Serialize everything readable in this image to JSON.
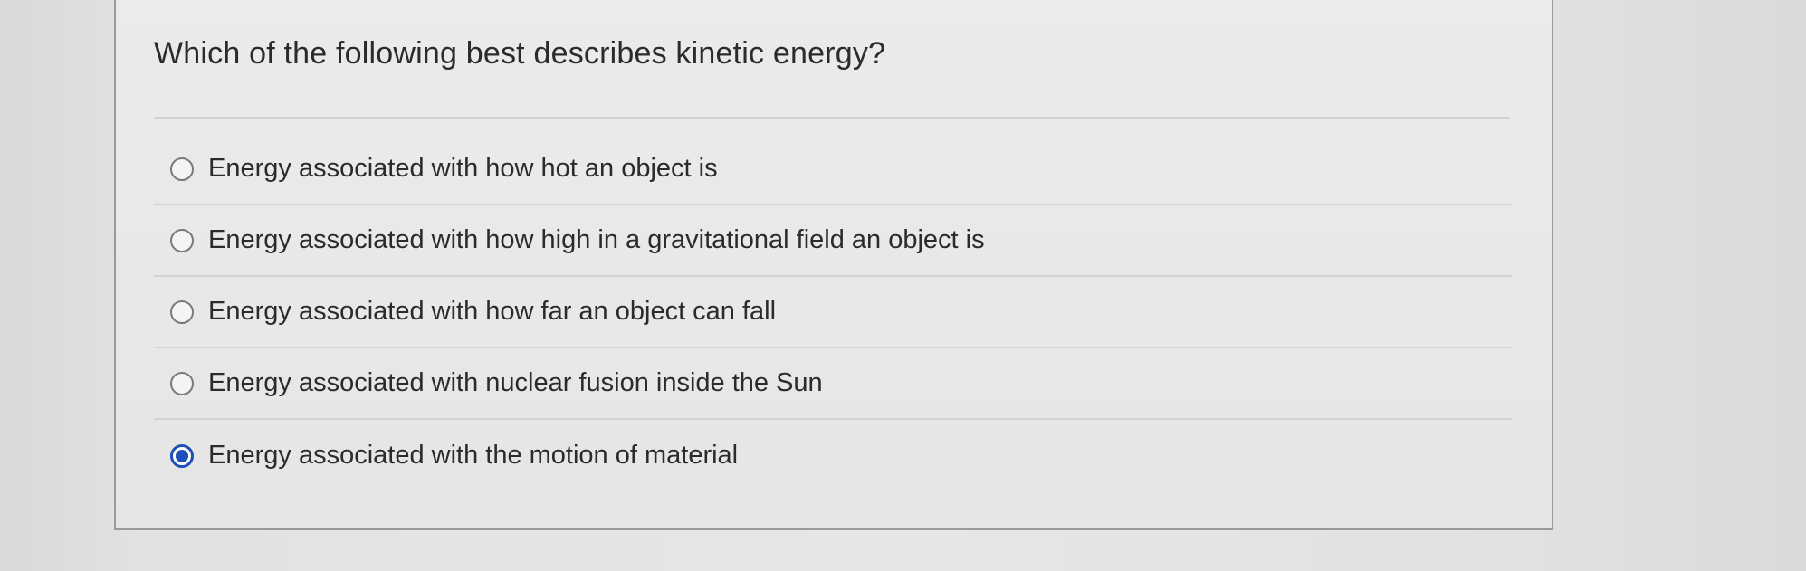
{
  "question": {
    "text": "Which of the following best describes kinetic energy?"
  },
  "answers": [
    {
      "label": "Energy associated with how hot an object is",
      "selected": false
    },
    {
      "label": "Energy associated with how high in a gravitational field an object is",
      "selected": false
    },
    {
      "label": "Energy associated with how far an object can fall",
      "selected": false
    },
    {
      "label": "Energy associated with nuclear fusion inside the Sun",
      "selected": false
    },
    {
      "label": "Energy associated with the motion of material",
      "selected": true
    }
  ],
  "colors": {
    "selected_radio": "#1e4fb8",
    "card_border": "#9a9a9a",
    "divider": "#d3d3d3"
  }
}
